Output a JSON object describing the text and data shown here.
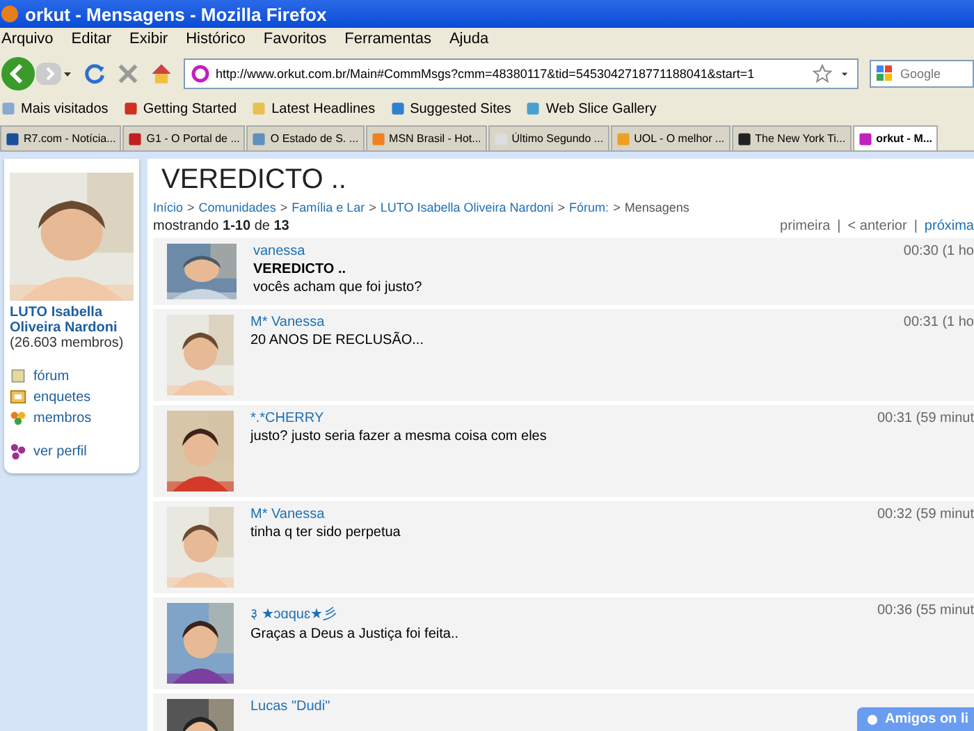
{
  "window": {
    "title": "orkut - Mensagens - Mozilla Firefox"
  },
  "menu": [
    "Arquivo",
    "Editar",
    "Exibir",
    "Histórico",
    "Favoritos",
    "Ferramentas",
    "Ajuda"
  ],
  "address": {
    "value": "http://www.orkut.com.br/Main#CommMsgs?cmm=48380117&tid=5453042718771188041&start=1"
  },
  "search": {
    "placeholder": "Google"
  },
  "bookmarks": [
    "Mais visitados",
    "Getting Started",
    "Latest Headlines",
    "Suggested Sites",
    "Web Slice Gallery"
  ],
  "tabs": [
    {
      "label": "R7.com - Notícia...",
      "selected": false
    },
    {
      "label": "G1 - O Portal de ...",
      "selected": false
    },
    {
      "label": "O Estado de S. ...",
      "selected": false
    },
    {
      "label": "MSN Brasil - Hot...",
      "selected": false
    },
    {
      "label": "Último Segundo ...",
      "selected": false
    },
    {
      "label": "UOL - O melhor ...",
      "selected": false
    },
    {
      "label": "The New York Ti...",
      "selected": false
    },
    {
      "label": "orkut - M...",
      "selected": true
    }
  ],
  "sidebar": {
    "community": "LUTO Isabella Oliveira Nardoni",
    "members": "(26.603 membros)",
    "links": [
      {
        "label": "fórum",
        "kind": "forum"
      },
      {
        "label": "enquetes",
        "kind": "polls"
      },
      {
        "label": "membros",
        "kind": "members"
      }
    ],
    "profile_link": "ver perfil"
  },
  "topic": {
    "title": "VEREDICTO ..",
    "breadcrumb": [
      {
        "label": "Início",
        "kind": "link"
      },
      {
        "label": ">",
        "kind": "separator"
      },
      {
        "label": "Comunidades",
        "kind": "link"
      },
      {
        "label": ">",
        "kind": "separator"
      },
      {
        "label": "Família e Lar",
        "kind": "link"
      },
      {
        "label": ">",
        "kind": "separator"
      },
      {
        "label": "LUTO Isabella Oliveira Nardoni",
        "kind": "link"
      },
      {
        "label": ">",
        "kind": "separator"
      },
      {
        "label": "Fórum:",
        "kind": "link"
      },
      {
        "label": ">",
        "kind": "separator"
      },
      {
        "label": "Mensagens",
        "kind": "current"
      }
    ],
    "showing": "mostrando **1-10** de **13**",
    "pager": [
      {
        "label": "primeira",
        "kind": "link",
        "disabled": true
      },
      {
        "label": "|",
        "kind": "separator"
      },
      {
        "label": "< anterior",
        "kind": "link",
        "disabled": true
      },
      {
        "label": "|",
        "kind": "separator"
      },
      {
        "label": "próxima",
        "kind": "link",
        "disabled": false
      }
    ]
  },
  "messages": [
    {
      "author": "vanessa",
      "subject": "VEREDICTO ..",
      "body": "vocês acham que foi justo?",
      "time": "00:30 (1 ho"
    },
    {
      "author": "M* Vanessa",
      "body": "20 ANOS DE RECLUSÃO...",
      "time": "00:31 (1 ho"
    },
    {
      "author": "*.*CHERRY",
      "body": "justo? justo seria fazer a mesma coisa com eles",
      "time": "00:31 (59 minut"
    },
    {
      "author": "M* Vanessa",
      "body": "tinha q ter sido perpetua",
      "time": "00:32 (59 minut"
    },
    {
      "author": "३ ★ɔɑquɛ★彡",
      "body": "Graças a Deus a Justiça foi feita..",
      "time": "00:36 (55 minut"
    },
    {
      "author": "Lucas \"Dudi\""
    }
  ],
  "chat_badge": "Amigos on li"
}
